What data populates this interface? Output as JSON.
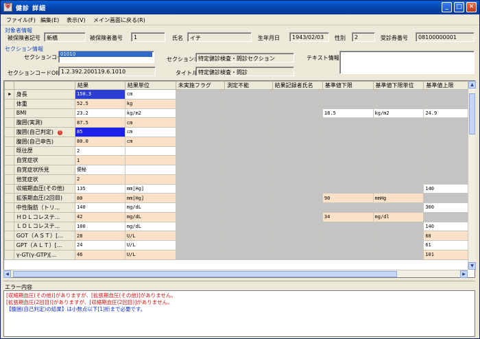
{
  "window": {
    "icon": "app-icon",
    "title": "健診 詳細"
  },
  "menu": [
    "ファイル(F)",
    "編集(E)",
    "表示(V)",
    "メイン画面に戻る(R)"
  ],
  "subject": {
    "group_label": "対象者情報",
    "insured_mark_label": "被保険者記号",
    "insured_mark": "新橋",
    "insured_no_label": "被保険者番号",
    "insured_no": "1",
    "name_label": "氏名",
    "name": "イチ",
    "birth_label": "生年月日",
    "birth": "1943/02/03",
    "sex_label": "性別",
    "sex": "2",
    "ticket_label": "受診券番号",
    "ticket": "08100000001"
  },
  "section": {
    "group_label": "セクション情報",
    "code_label": "セクションコード",
    "code": "01010",
    "oid_label": "セクションコードOID",
    "oid": "1.2.392.200119.6.1010",
    "name_label": "セクション名",
    "name": "特定健診検査・問診セクション",
    "title_label": "タイトル",
    "title": "特定健診検査・問診",
    "text_label": "テキスト情報",
    "text": ""
  },
  "grid": {
    "columns": [
      "結果",
      "結果単位",
      "未実施フラグ",
      "測定不能",
      "結果記録者氏名",
      "基準値下限",
      "基準値下限単位",
      "基準値上限"
    ],
    "rows": [
      {
        "name": "身長",
        "result": "150.3",
        "unit": "cm",
        "lower": "",
        "lower_unit": "",
        "upper": ""
      },
      {
        "name": "体重",
        "result": "52.5",
        "unit": "kg",
        "lower": "",
        "lower_unit": "",
        "upper": ""
      },
      {
        "name": "BMI",
        "result": "23.2",
        "unit": "kg/m2",
        "lower": "18.5",
        "lower_unit": "kg/m2",
        "upper": "24.9"
      },
      {
        "name": "腹囲(実測)",
        "result": "87.5",
        "unit": "cm",
        "lower": "",
        "lower_unit": "",
        "upper": ""
      },
      {
        "name": "腹囲(自己判定)",
        "result": "85",
        "unit": "cm",
        "lower": "",
        "lower_unit": "",
        "upper": ""
      },
      {
        "name": "腹囲(自己申告)",
        "result": "80.0",
        "unit": "cm",
        "lower": "",
        "lower_unit": "",
        "upper": ""
      },
      {
        "name": "既往歴",
        "result": "2",
        "unit": "",
        "lower": "",
        "lower_unit": "",
        "upper": ""
      },
      {
        "name": "自覚症状",
        "result": "1",
        "unit": "",
        "lower": "",
        "lower_unit": "",
        "upper": ""
      },
      {
        "name": "自覚症状所見",
        "result": "便秘",
        "unit": "",
        "lower": "",
        "lower_unit": "",
        "upper": ""
      },
      {
        "name": "他覚症状",
        "result": "2",
        "unit": "",
        "lower": "",
        "lower_unit": "",
        "upper": ""
      },
      {
        "name": "収縮期血圧(その他)",
        "result": "135",
        "unit": "mm[Hg]",
        "lower": "",
        "lower_unit": "",
        "upper": "140"
      },
      {
        "name": "拡張期血圧(2回目)",
        "result": "80",
        "unit": "mm[Hg]",
        "lower": "90",
        "lower_unit": "mmHg",
        "upper": ""
      },
      {
        "name": "中性脂肪（トリ...",
        "result": "140",
        "unit": "mg/dL",
        "lower": "",
        "lower_unit": "",
        "upper": "300"
      },
      {
        "name": "ＨＤＬコレステ...",
        "result": "42",
        "unit": "mg/dL",
        "lower": "34",
        "lower_unit": "mg/dl",
        "upper": ""
      },
      {
        "name": "ＬＤＬコレステ...",
        "result": "100",
        "unit": "mg/dL",
        "lower": "",
        "lower_unit": "",
        "upper": "140"
      },
      {
        "name": "GOT（ＡＳＴ）[...",
        "result": "28",
        "unit": "U/L",
        "lower": "",
        "lower_unit": "",
        "upper": "60"
      },
      {
        "name": "GPT（ＡＬＴ）[...",
        "result": "24",
        "unit": "U/L",
        "lower": "",
        "lower_unit": "",
        "upper": "61"
      },
      {
        "name": "γ-GT(γ-GTP)[...",
        "result": "46",
        "unit": "U/L",
        "lower": "",
        "lower_unit": "",
        "upper": "101"
      }
    ],
    "selected_row": 0,
    "editing_row": 4,
    "error_row": 4,
    "error_icon": "error-icon",
    "row_indicator_icon": "current-row-triangle-icon"
  },
  "errors": {
    "header": "エラー内容",
    "lines": [
      {
        "text": "[収縮期血圧(その他)]がありますが、[拡張期血圧(その他)]がありません。",
        "color": "#d01010"
      },
      {
        "text": "[拡張期血圧(2回目)]がありますが、[収縮期血圧(2回目)]がありません。",
        "color": "#d01010"
      },
      {
        "text": "【腹囲(自己判定)の結果】は小数点以下[1]桁まで必要です。",
        "color": "#1030c8"
      }
    ]
  }
}
